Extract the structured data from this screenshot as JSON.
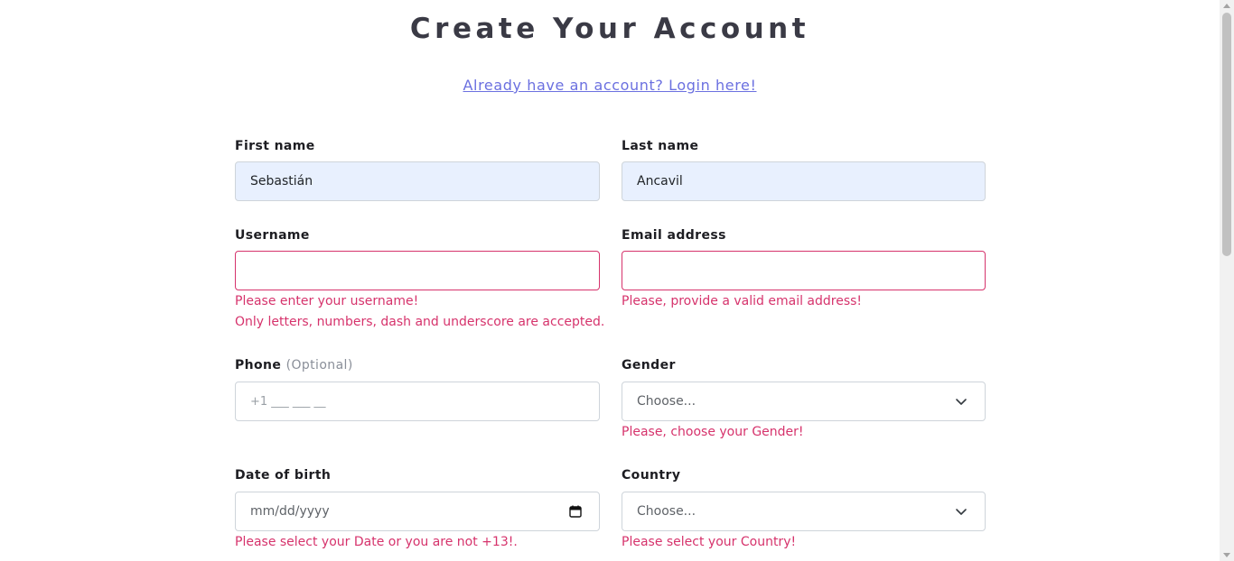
{
  "page": {
    "title": "Create Your Account",
    "login_link": "Already have an account? Login here!"
  },
  "form": {
    "first_name": {
      "label": "First name",
      "value": "Sebastián"
    },
    "last_name": {
      "label": "Last name",
      "value": "Ancavil"
    },
    "username": {
      "label": "Username",
      "value": "",
      "error_1": "Please enter your username!",
      "error_2": "Only letters, numbers, dash and underscore are accepted."
    },
    "email": {
      "label": "Email address",
      "value": "",
      "error": "Please, provide a valid email address!"
    },
    "phone": {
      "label": "Phone",
      "optional": "(Optional)",
      "placeholder": "+1 ___ ___ __"
    },
    "gender": {
      "label": "Gender",
      "selected": "Choose...",
      "error": "Please, choose your Gender!"
    },
    "dob": {
      "label": "Date of birth",
      "placeholder": "mm/dd/yyyy",
      "error": "Please select your Date or you are not +13!."
    },
    "country": {
      "label": "Country",
      "selected": "Choose...",
      "error": "Please select your Country!"
    }
  },
  "colors": {
    "error": "#d6336c",
    "link": "#6b70e0",
    "autofill": "#e8f0fe"
  },
  "icons": {
    "select_caret": "chevron-down-icon",
    "date_picker": "calendar-icon"
  }
}
